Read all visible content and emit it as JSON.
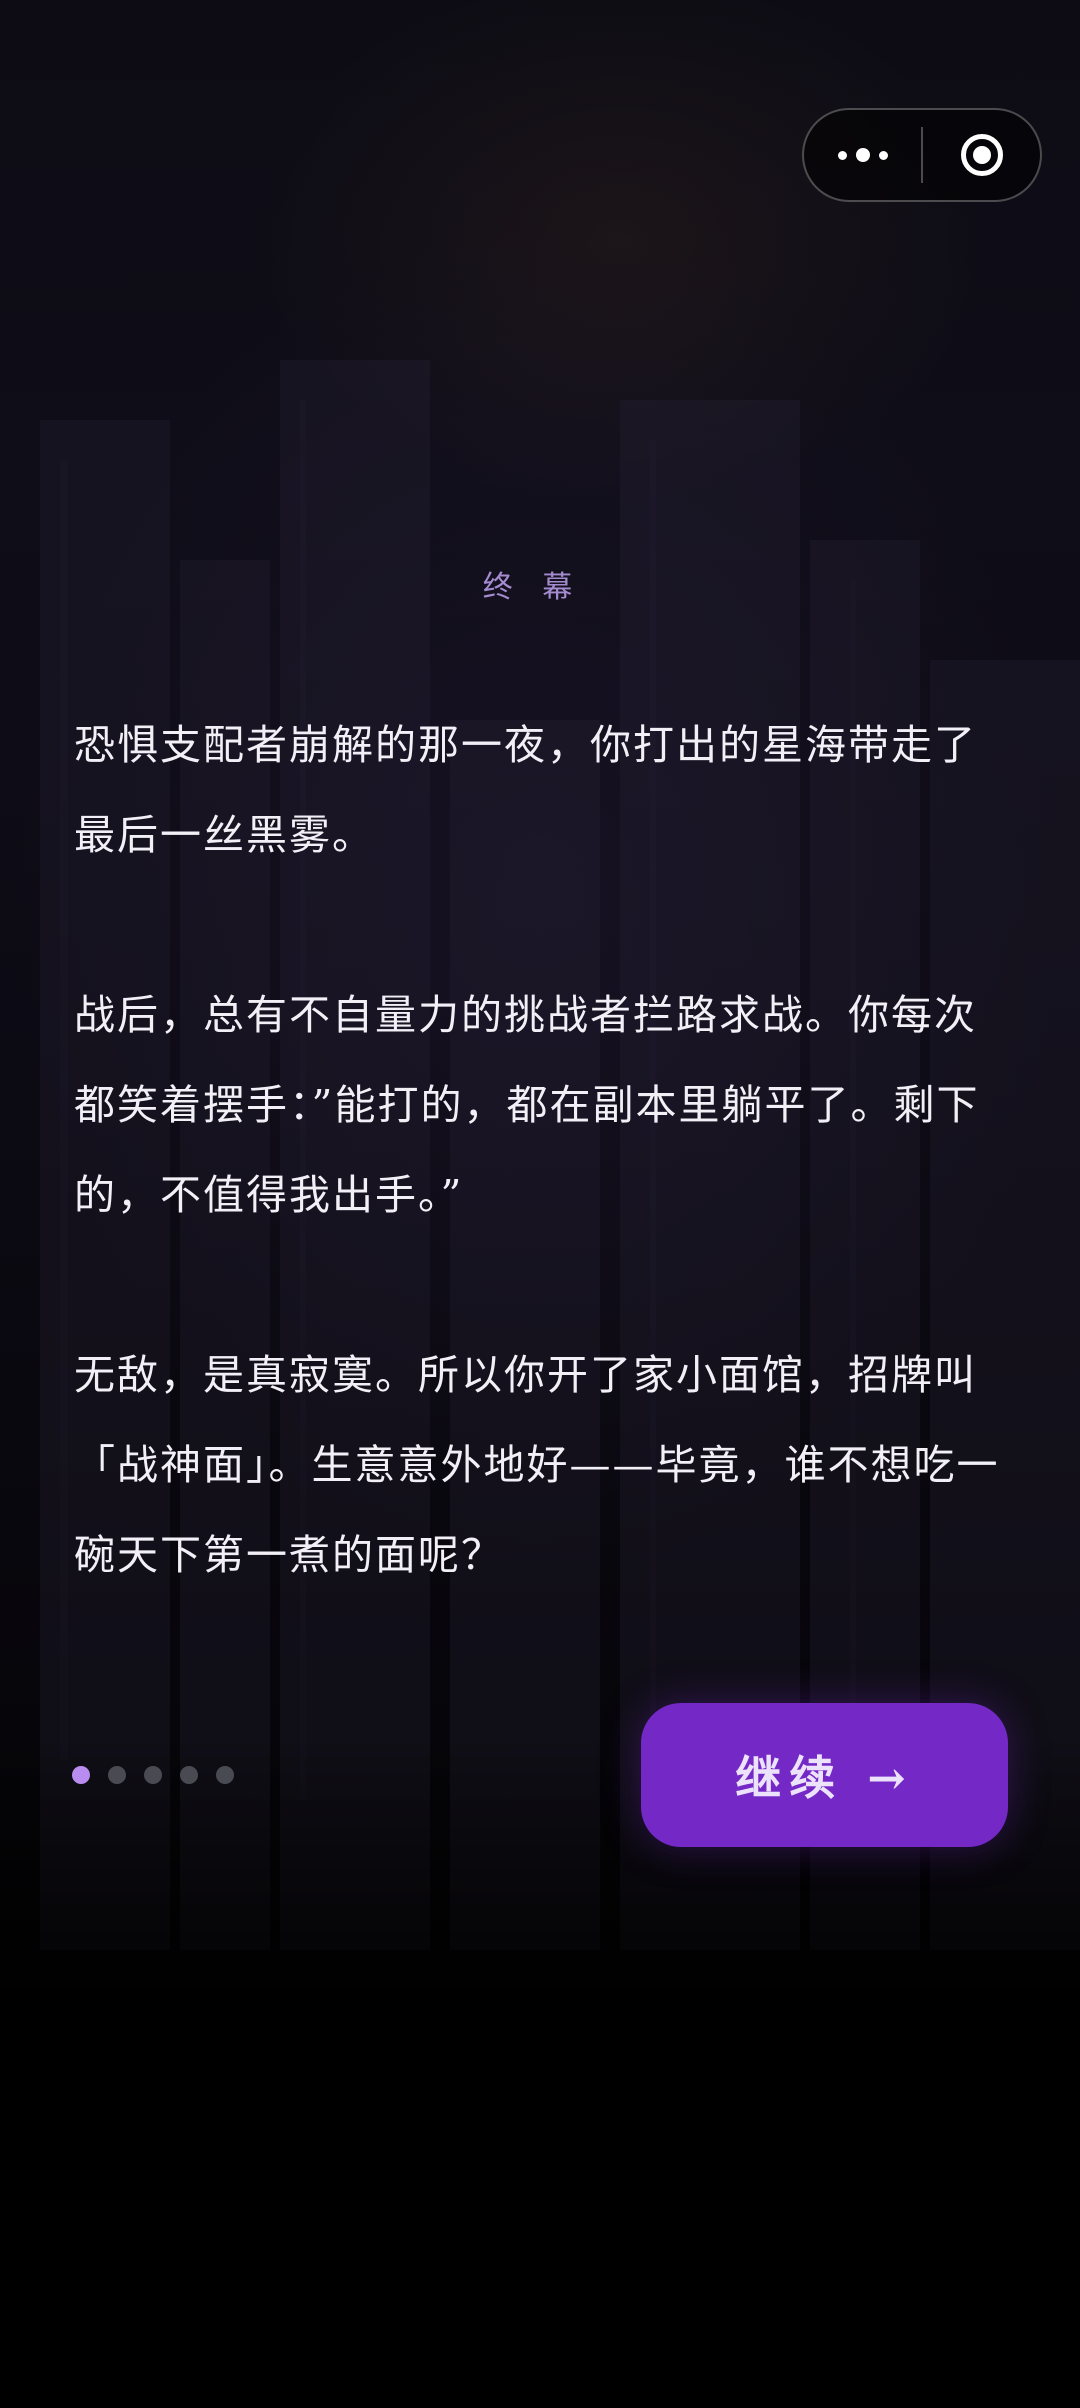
{
  "chapter": {
    "title": "终 幕"
  },
  "story": {
    "paragraphs": [
      "恐惧支配者崩解的那一夜，你打出的星海带走了最后一丝黑雾。",
      "战后，总有不自量力的挑战者拦路求战。你每次都笑着摆手：”能打的，都在副本里躺平了。剩下的，不值得我出手。”",
      "无敌，是真寂寞。所以你开了家小面馆，招牌叫「战神面」。生意意外地好——毕竟，谁不想吃一碗天下第一煮的面呢？"
    ]
  },
  "pager": {
    "total": 5,
    "current": 1,
    "active_color": "#b98cf0",
    "inactive_color": "#4a4a52"
  },
  "actions": {
    "continue_label": "继续 →"
  },
  "capsule": {
    "more_icon": "more-dots-icon",
    "close_icon": "close-circle-icon"
  },
  "colors": {
    "accent": "#7428c6",
    "title": "#a48bd0",
    "text": "#f2f0f6"
  }
}
